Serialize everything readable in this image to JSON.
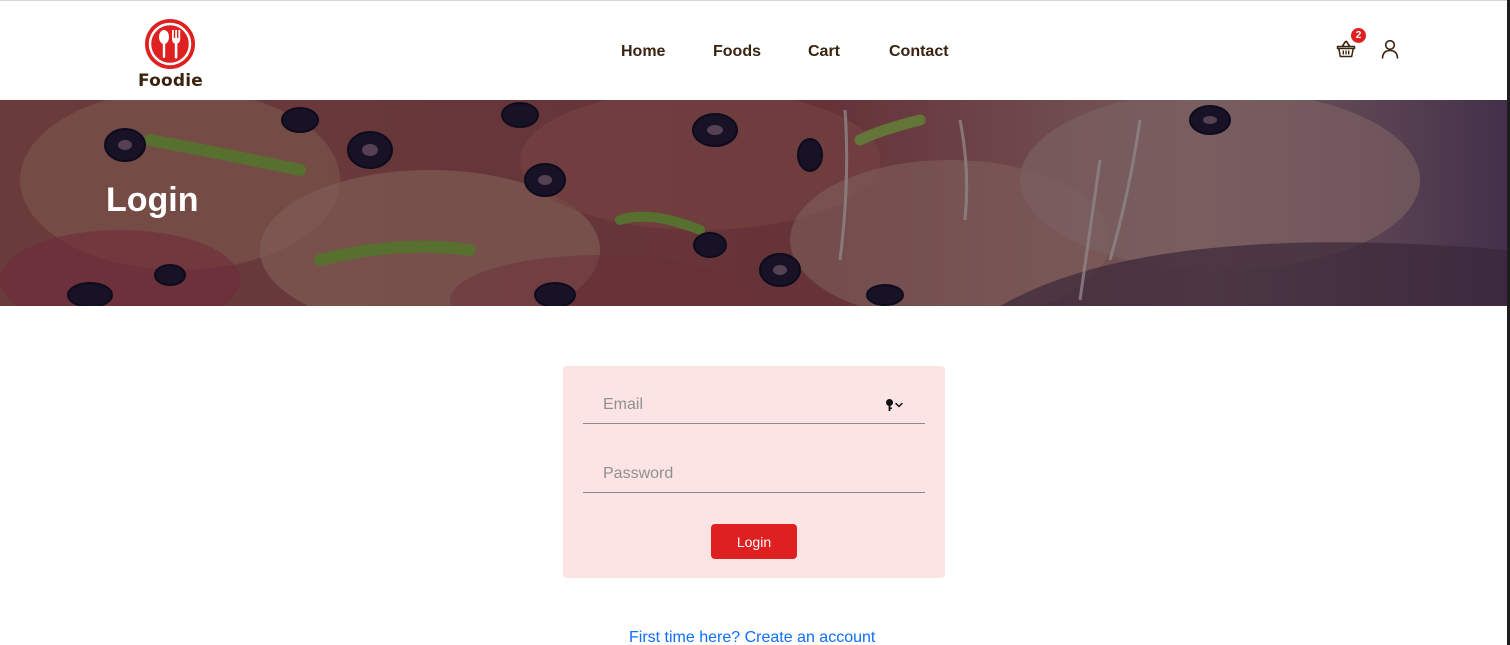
{
  "brand": {
    "name": "Foodie",
    "logo_icon": "spoon-fork-icon",
    "color": "#df2020"
  },
  "nav": {
    "items": [
      {
        "label": "Home"
      },
      {
        "label": "Foods"
      },
      {
        "label": "Cart"
      },
      {
        "label": "Contact"
      }
    ]
  },
  "header_actions": {
    "cart_icon": "shopping-basket-icon",
    "cart_count": "2",
    "user_icon": "user-icon"
  },
  "hero": {
    "title": "Login",
    "background": "pizza-photo"
  },
  "login_form": {
    "email_placeholder": "Email",
    "password_placeholder": "Password",
    "autofill_icon": "key-icon",
    "submit_label": "Login"
  },
  "signup_link": "First time here? Create an account",
  "colors": {
    "accent": "#df2020",
    "text_dark": "#3a2410",
    "card_bg": "#fde4e4",
    "link": "#0d6efd"
  }
}
